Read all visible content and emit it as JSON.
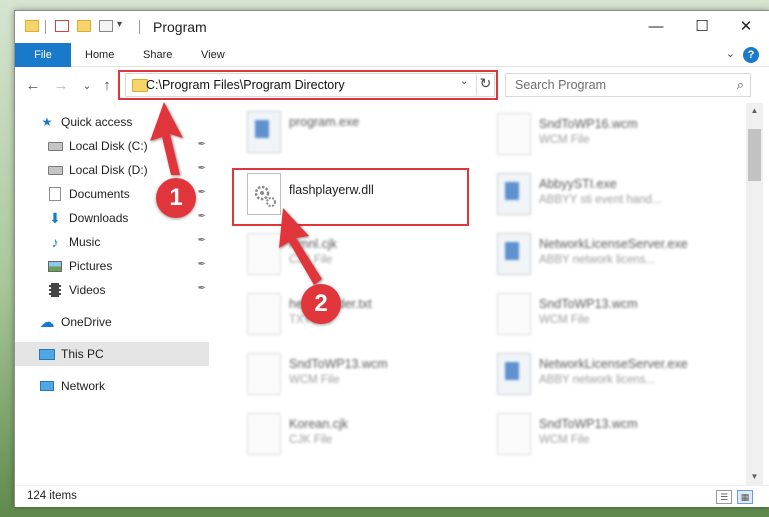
{
  "window": {
    "title": "Program",
    "min_glyph": "—",
    "max_glyph": "☐",
    "close_glyph": "✕"
  },
  "quick_access_toolbar": {
    "dropdown_glyph": "▾"
  },
  "ribbon": {
    "tabs": [
      "File",
      "Home",
      "Share",
      "View"
    ],
    "collapse_glyph": "⌄",
    "help_glyph": "?"
  },
  "nav_buttons": {
    "back_glyph": "←",
    "forward_glyph": "→",
    "recent_glyph": "⌄",
    "up_glyph": "↑"
  },
  "address_bar": {
    "path": "C:\\Program Files\\Program Directory",
    "dropdown_glyph": "⌄",
    "refresh_glyph": "↻"
  },
  "search": {
    "placeholder": "Search Program",
    "icon_glyph": "⌕"
  },
  "nav_pane": {
    "quick_access": "Quick access",
    "items": [
      {
        "label": "Local Disk (C:)",
        "icon": "drive-icon"
      },
      {
        "label": "Local Disk (D:)",
        "icon": "drive-icon"
      },
      {
        "label": "Documents",
        "icon": "documents-icon"
      },
      {
        "label": "Downloads",
        "icon": "downloads-icon"
      },
      {
        "label": "Music",
        "icon": "music-icon"
      },
      {
        "label": "Pictures",
        "icon": "pictures-icon"
      },
      {
        "label": "Videos",
        "icon": "videos-icon"
      }
    ],
    "onedrive": "OneDrive",
    "this_pc": "This PC",
    "network": "Network",
    "pin_glyph": "📌"
  },
  "files": {
    "col1": [
      {
        "name": "program.exe",
        "type": ""
      },
      {
        "name": "flashplayerw.dll",
        "type": ""
      },
      {
        "name": "Hmnl.cjk",
        "type": "CJK File"
      },
      {
        "name": "help_reader.txt",
        "type": "TXT File"
      },
      {
        "name": "SndToWP13.wcm",
        "type": "WCM File"
      },
      {
        "name": "Korean.cjk",
        "type": "CJK File"
      }
    ],
    "col2": [
      {
        "name": "SndToWP16.wcm",
        "type": "WCM File"
      },
      {
        "name": "AbbyySTI.exe",
        "type": "ABBYY sti event hand..."
      },
      {
        "name": "NetworkLicenseServer.exe",
        "type": "ABBY network licens..."
      },
      {
        "name": "SndToWP13.wcm",
        "type": "WCM File"
      },
      {
        "name": "NetworkLicenseServer.exe",
        "type": "ABBY network licens..."
      },
      {
        "name": "SndToWP13.wcm",
        "type": "WCM File"
      }
    ]
  },
  "status_bar": {
    "item_count": "124 items"
  },
  "annotations": {
    "badge1": "1",
    "badge2": "2",
    "color": "#e0353b"
  }
}
